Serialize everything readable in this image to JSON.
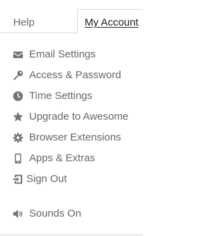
{
  "tabs": {
    "help": "Help",
    "my_account": "My Account",
    "active": "my_account"
  },
  "menu": {
    "items": [
      {
        "label": "Email Settings",
        "icon": "envelope-icon"
      },
      {
        "label": "Access & Password",
        "icon": "key-icon"
      },
      {
        "label": "Time Settings",
        "icon": "clock-icon"
      },
      {
        "label": "Upgrade to Awesome",
        "icon": "star-icon"
      },
      {
        "label": "Browser Extensions",
        "icon": "gear-icon"
      },
      {
        "label": "Apps & Extras",
        "icon": "mobile-phone-icon"
      },
      {
        "label": "Sign Out",
        "icon": "sign-out-icon"
      }
    ],
    "sounds": {
      "label": "Sounds On",
      "icon": "speaker-icon"
    }
  },
  "colors": {
    "icon": "#757575",
    "text": "#666666",
    "active_tab_text": "#222222",
    "border": "#d9d9d9"
  }
}
